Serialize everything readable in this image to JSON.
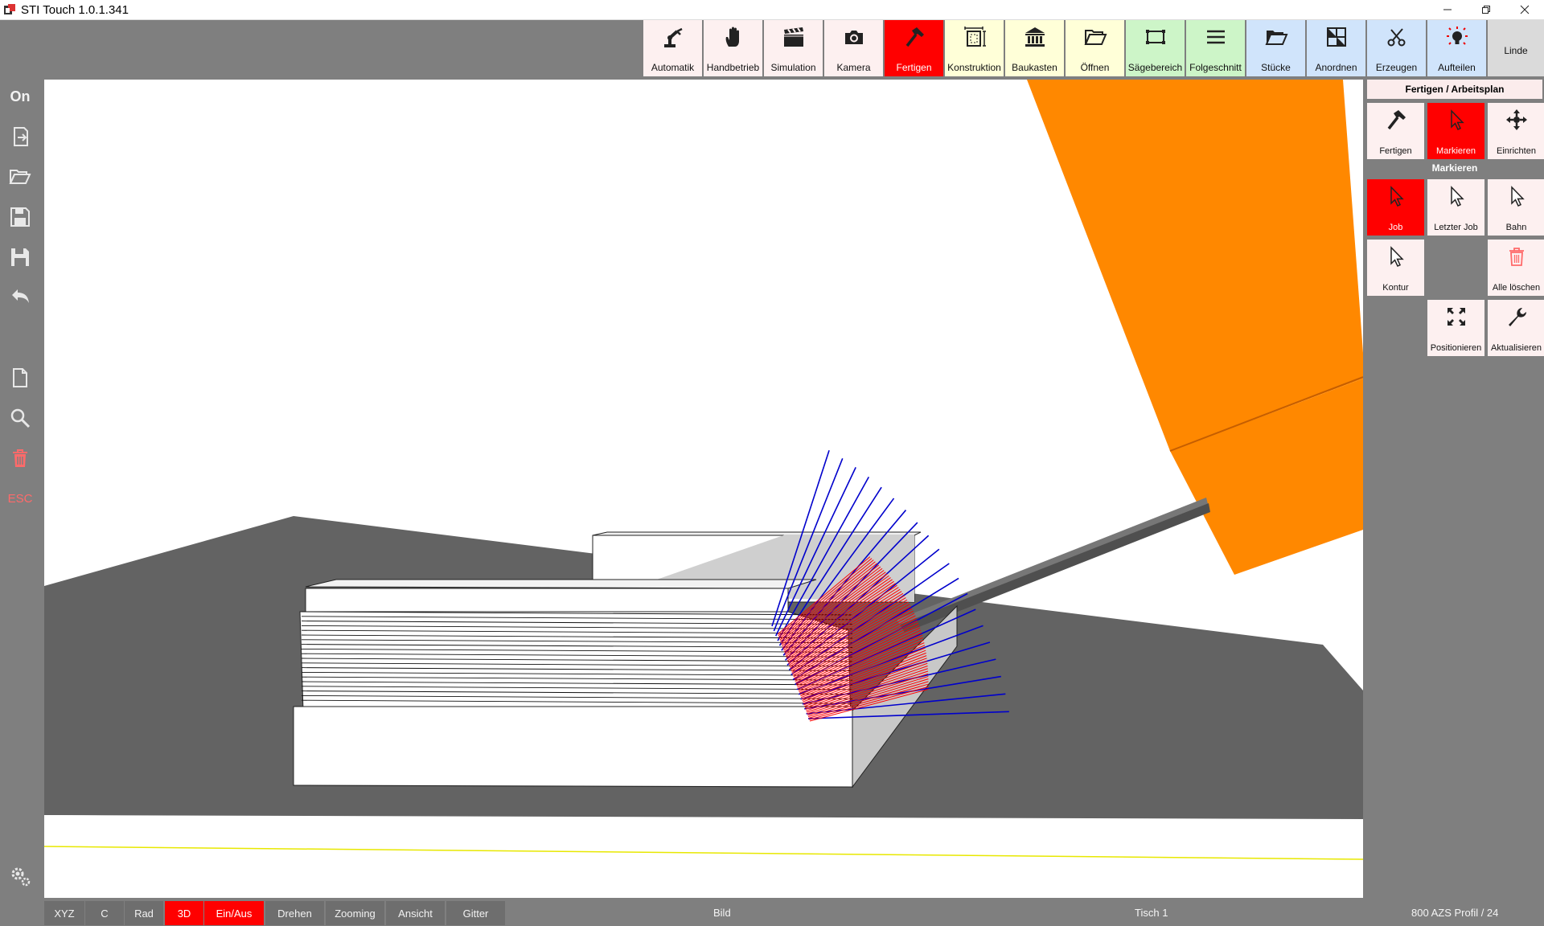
{
  "window": {
    "title": "STI Touch 1.0.1.341"
  },
  "toolbar": {
    "items": [
      {
        "label": "Automatik",
        "icon": "robot-arm-icon",
        "bg": "#fdf0f0",
        "active": false
      },
      {
        "label": "Handbetrieb",
        "icon": "hand-icon",
        "bg": "#fdf0f0",
        "active": false
      },
      {
        "label": "Simulation",
        "icon": "clapperboard-icon",
        "bg": "#fdf0f0",
        "active": false
      },
      {
        "label": "Kamera",
        "icon": "camera-icon",
        "bg": "#fdf0f0",
        "active": false
      },
      {
        "label": "Fertigen",
        "icon": "hammer-icon",
        "bg": "#ff0000",
        "active": true
      },
      {
        "label": "Konstruktion",
        "icon": "construction-icon",
        "bg": "#ffffd8",
        "active": false
      },
      {
        "label": "Baukasten",
        "icon": "building-icon",
        "bg": "#ffffd8",
        "active": false
      },
      {
        "label": "Öffnen",
        "icon": "folder-open-icon",
        "bg": "#ffffd8",
        "active": false
      },
      {
        "label": "Sägebereich",
        "icon": "saw-area-icon",
        "bg": "#cdf5c8",
        "active": false
      },
      {
        "label": "Folgeschnitt",
        "icon": "lines-icon",
        "bg": "#cdf5c8",
        "active": false
      },
      {
        "label": "Stücke",
        "icon": "folder-icon",
        "bg": "#d0e4fb",
        "active": false
      },
      {
        "label": "Anordnen",
        "icon": "arrange-icon",
        "bg": "#d0e4fb",
        "active": false
      },
      {
        "label": "Erzeugen",
        "icon": "scissors-icon",
        "bg": "#d0e4fb",
        "active": false
      },
      {
        "label": "Aufteilen",
        "icon": "lightbulb-icon",
        "bg": "#d0e4fb",
        "active": false
      }
    ],
    "linde_label": "Linde"
  },
  "sidebar": {
    "on_label": "On",
    "esc_label": "ESC"
  },
  "right_panel": {
    "header": "Fertigen / Arbeitsplan",
    "top_buttons": [
      {
        "label": "Fertigen",
        "icon": "hammer-icon",
        "active": false
      },
      {
        "label": "Markieren",
        "icon": "cursor-icon",
        "active": true
      },
      {
        "label": "Einrichten",
        "icon": "move-arrows-icon",
        "active": false
      }
    ],
    "section_label": "Markieren",
    "mark_buttons": [
      {
        "label": "Job",
        "icon": "cursor-icon",
        "active": true
      },
      {
        "label": "Letzter Job",
        "icon": "cursor-icon",
        "active": false
      },
      {
        "label": "Bahn",
        "icon": "cursor-icon",
        "active": false
      },
      {
        "label": "Kontur",
        "icon": "cursor-icon",
        "active": false
      },
      {
        "label": "Alle löschen",
        "icon": "trash-icon",
        "active": false
      },
      {
        "label": "Positionieren",
        "icon": "expand-icon",
        "active": false
      },
      {
        "label": "Aktualisieren",
        "icon": "wrench-icon",
        "active": false
      }
    ]
  },
  "statusbar": {
    "buttons": [
      {
        "label": "XYZ",
        "active": false
      },
      {
        "label": "C",
        "active": false
      },
      {
        "label": "Rad",
        "active": false
      },
      {
        "label": "3D",
        "active": true
      },
      {
        "label": "Ein/Aus",
        "active": true
      },
      {
        "label": "Drehen",
        "active": false
      },
      {
        "label": "Zooming",
        "active": false
      },
      {
        "label": "Ansicht",
        "active": false
      },
      {
        "label": "Gitter",
        "active": false
      }
    ],
    "bild": "Bild",
    "tisch": "Tisch 1",
    "profil": "800 AZS Profil / 24"
  },
  "colors": {
    "accent_red": "#ff0000",
    "path_blue": "#0000cc",
    "path_red": "#ff0000",
    "tool_orange": "#ff8800"
  }
}
